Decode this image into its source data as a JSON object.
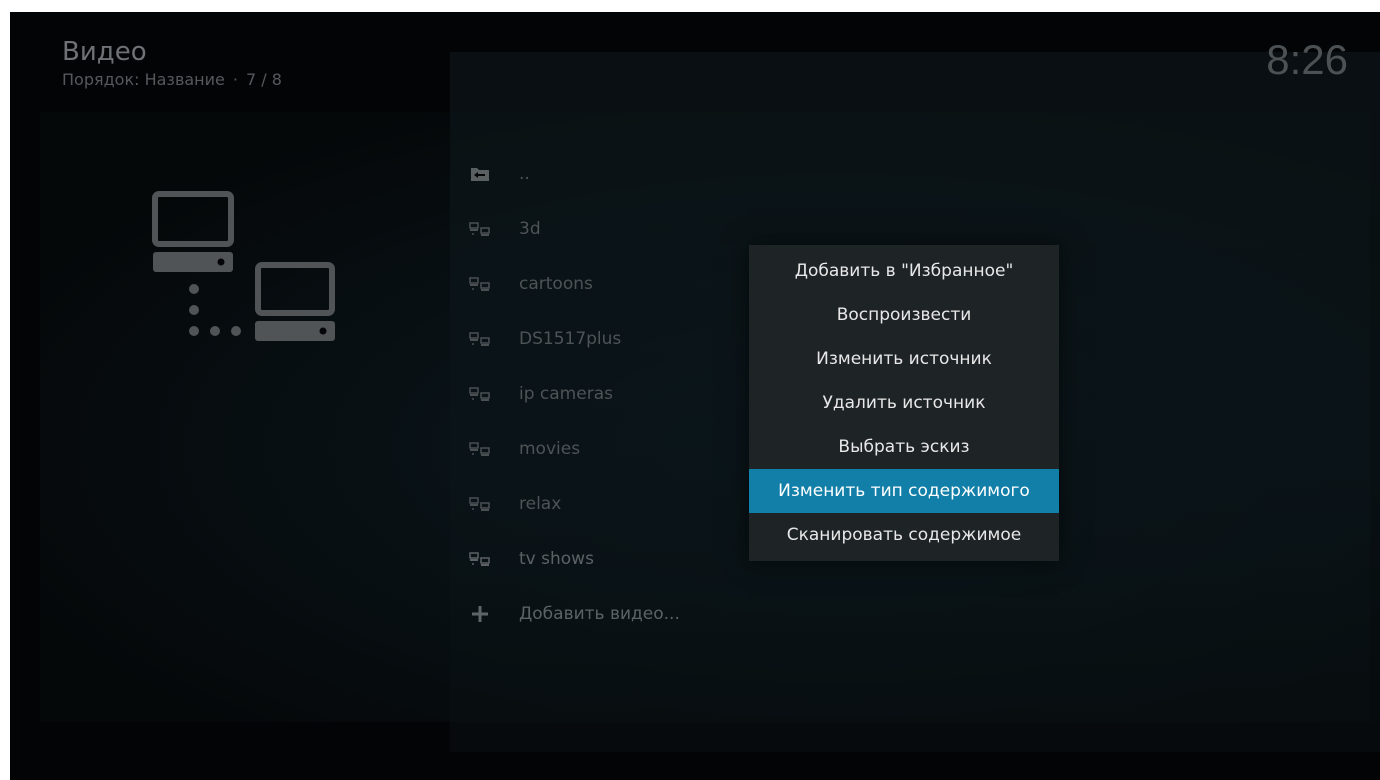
{
  "header": {
    "title": "Видео",
    "sort_label": "Порядок: Название",
    "separator": "·",
    "position": "7 / 8"
  },
  "clock": "8:26",
  "files": [
    {
      "label": "..",
      "icon": "folder-back-icon"
    },
    {
      "label": "3d",
      "icon": "network-source-icon"
    },
    {
      "label": "cartoons",
      "icon": "network-source-icon"
    },
    {
      "label": "DS1517plus",
      "icon": "network-source-icon"
    },
    {
      "label": "ip cameras",
      "icon": "network-source-icon"
    },
    {
      "label": "movies",
      "icon": "network-source-icon"
    },
    {
      "label": "relax",
      "icon": "network-source-icon"
    },
    {
      "label": "tv shows",
      "icon": "network-source-icon"
    },
    {
      "label": "Добавить видео...",
      "icon": "plus-icon"
    }
  ],
  "context_menu": {
    "items": [
      {
        "label": "Добавить в \"Избранное\""
      },
      {
        "label": "Воспроизвести"
      },
      {
        "label": "Изменить источник"
      },
      {
        "label": "Удалить источник"
      },
      {
        "label": "Выбрать эскиз"
      },
      {
        "label": "Изменить тип содержимого",
        "selected": true
      },
      {
        "label": "Сканировать содержимое"
      }
    ]
  },
  "colors": {
    "accent": "#127fa8",
    "menu_bg": "#1e2326",
    "background": "#030405"
  }
}
